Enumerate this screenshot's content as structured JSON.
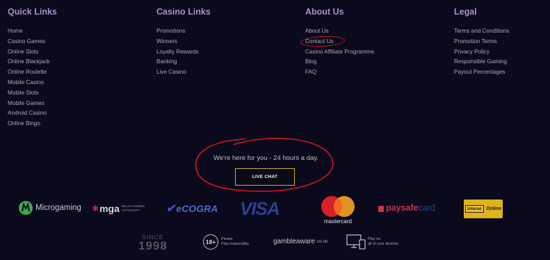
{
  "footer": {
    "columns": [
      {
        "title": "Quick Links",
        "items": [
          "Home",
          "Casino Games",
          "Online Slots",
          "Online Blackjack",
          "Online Roulette",
          "Mobile Casino",
          "Mobile Slots",
          "Mobile Games",
          "Android Casino",
          "Online Bingo"
        ]
      },
      {
        "title": "Casino Links",
        "items": [
          "Promotions",
          "Winners",
          "Loyalty Rewards",
          "Banking",
          "Live Casino"
        ]
      },
      {
        "title": "About Us",
        "items": [
          "About Us",
          "Contact Us",
          "Casino Affiliate Programme",
          "Blog",
          "FAQ"
        ]
      },
      {
        "title": "Legal",
        "items": [
          "Terms and Conditions",
          "Promotion Terms",
          "Privacy Policy",
          "Responsible Gaming",
          "Payout Percentages"
        ]
      }
    ],
    "support": {
      "text": "We're here for you - 24 hours a day.",
      "button_label": "LIVE CHAT"
    },
    "logos": {
      "microgaming": "Microgaming",
      "mga": "mga",
      "mga_sub1": "MALTA GAMING",
      "mga_sub2": "AUTHORITY",
      "ecogra": "eCOGRA",
      "visa": "VISA",
      "mastercard": "mastercard",
      "paysafe_a": "paysafe",
      "paysafe_b": "card",
      "interac_a": "Interac",
      "interac_b": "Online",
      "since": "SINCE",
      "since_year": "1998",
      "age": "18+",
      "age_line1": "Please",
      "age_line2": "Play responsibly",
      "gambleaware": "gambleaware",
      "gambleaware_tld": ".co.uk",
      "devices_line1": "Play on",
      "devices_line2": "all of your devices"
    },
    "colors": {
      "background": "#0a0a1c",
      "heading": "#a98fcb",
      "annotation": "#d0151b",
      "button_border": "#d5a93a"
    }
  }
}
